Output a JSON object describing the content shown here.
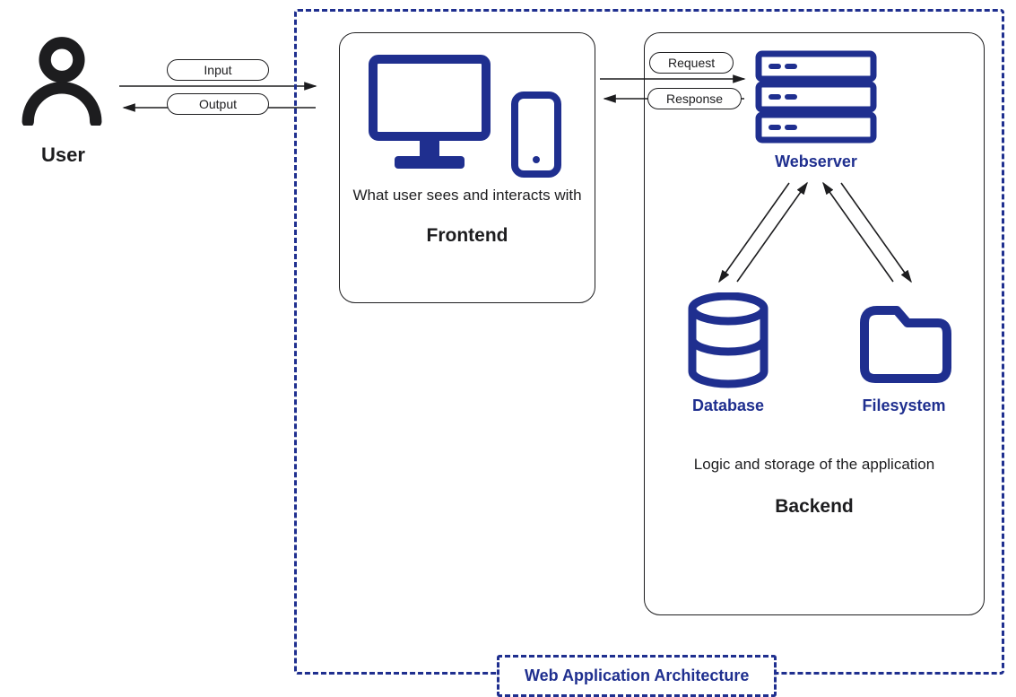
{
  "diagram": {
    "title": "Web Application Architecture",
    "user": {
      "label": "User"
    },
    "io": {
      "input": "Input",
      "output": "Output"
    },
    "frontend": {
      "desc": "What user sees and interacts with",
      "title": "Frontend"
    },
    "reqres": {
      "request": "Request",
      "response": "Response"
    },
    "backend": {
      "webserver": "Webserver",
      "database": "Database",
      "filesystem": "Filesystem",
      "desc": "Logic and storage of the application",
      "title": "Backend"
    }
  }
}
